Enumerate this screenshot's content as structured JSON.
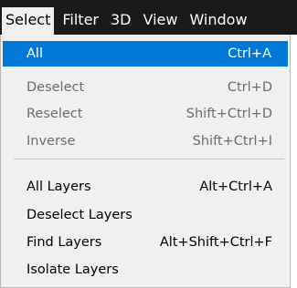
{
  "menubar": {
    "items": [
      {
        "label": "Select"
      },
      {
        "label": "Filter"
      },
      {
        "label": "3D"
      },
      {
        "label": "View"
      },
      {
        "label": "Window"
      }
    ],
    "active_index": 0
  },
  "colors": {
    "menubar_bg": "#1a1a1a",
    "menu_bg": "#f0f0f0",
    "highlight": "#0078d7",
    "disabled_text": "#6d6d6d"
  },
  "menu": {
    "groups": [
      [
        {
          "label": "All",
          "shortcut": "Ctrl+A",
          "state": "highlighted"
        },
        {
          "label": "Deselect",
          "shortcut": "Ctrl+D",
          "state": "disabled"
        },
        {
          "label": "Reselect",
          "shortcut": "Shift+Ctrl+D",
          "state": "disabled"
        },
        {
          "label": "Inverse",
          "shortcut": "Shift+Ctrl+I",
          "state": "disabled"
        }
      ],
      [
        {
          "label": "All Layers",
          "shortcut": "Alt+Ctrl+A",
          "state": "enabled"
        },
        {
          "label": "Deselect Layers",
          "shortcut": "",
          "state": "enabled"
        },
        {
          "label": "Find Layers",
          "shortcut": "Alt+Shift+Ctrl+F",
          "state": "enabled"
        },
        {
          "label": "Isolate Layers",
          "shortcut": "",
          "state": "enabled"
        }
      ]
    ]
  }
}
